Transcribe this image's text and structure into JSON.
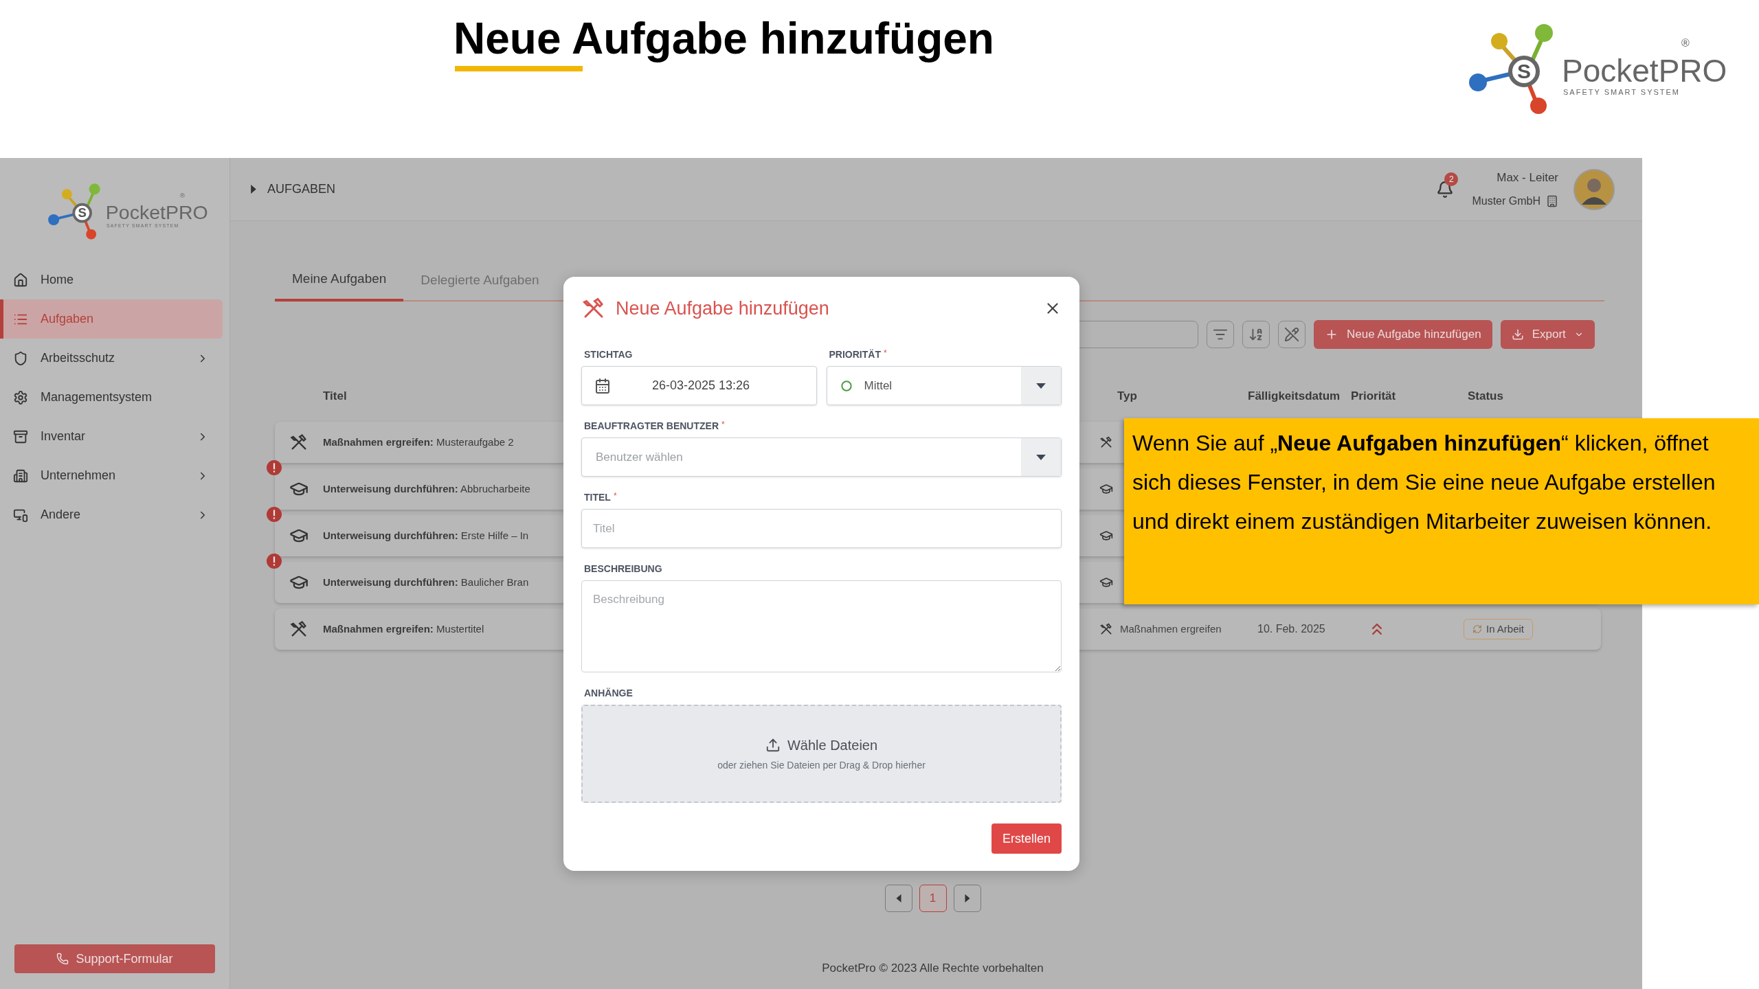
{
  "slide": {
    "title": "Neue Aufgabe hinzufügen",
    "logo": {
      "mark": "S",
      "name": "PocketPRO",
      "registered": "®",
      "tagline": "SAFETY SMART SYSTEM"
    }
  },
  "sidebar": {
    "logo": {
      "mark": "S",
      "name": "PocketPRO",
      "registered": "®",
      "tagline": "SAFETY SMART SYSTEM"
    },
    "items": [
      {
        "label": "Home",
        "selected": false,
        "has_submenu": false
      },
      {
        "label": "Aufgaben",
        "selected": true,
        "has_submenu": false
      },
      {
        "label": "Arbeitsschutz",
        "selected": false,
        "has_submenu": true
      },
      {
        "label": "Managementsystem",
        "selected": false,
        "has_submenu": false
      },
      {
        "label": "Inventar",
        "selected": false,
        "has_submenu": true
      },
      {
        "label": "Unternehmen",
        "selected": false,
        "has_submenu": true
      },
      {
        "label": "Andere",
        "selected": false,
        "has_submenu": true
      }
    ],
    "support_button": "Support-Formular"
  },
  "header": {
    "breadcrumb": "AUFGABEN",
    "notification_count": "2",
    "user_name": "Max - Leiter",
    "company": "Muster GmbH"
  },
  "tabs": [
    {
      "label": "Meine Aufgaben",
      "selected": true
    },
    {
      "label": "Delegierte Aufgaben",
      "selected": false
    }
  ],
  "toolbar": {
    "add_button": "Neue Aufgabe hinzufügen",
    "export_button": "Export"
  },
  "table": {
    "columns": [
      "Titel",
      "Typ",
      "Fälligkeitsdatum",
      "Priorität",
      "Status"
    ],
    "rows": [
      {
        "kind": "measure",
        "overdue": false,
        "title": "**Maßnahmen ergreifen:** Musteraufgabe 2"
      },
      {
        "kind": "training",
        "overdue": true,
        "title": "**Unterweisung durchführen:** Abbrucharbeite"
      },
      {
        "kind": "training",
        "overdue": true,
        "title": "**Unterweisung durchführen:** Erste Hilfe – In"
      },
      {
        "kind": "training",
        "overdue": true,
        "title": "**Unterweisung durchführen:** Baulicher Bran"
      },
      {
        "kind": "measure",
        "overdue": false,
        "title": "**Maßnahmen ergreifen:** Mustertitel",
        "type": "Maßnahmen ergreifen",
        "due_date": "10. Feb. 2025",
        "priority": {
          "kind": "high"
        },
        "status": "In Arbeit"
      }
    ]
  },
  "pagination": [
    {
      "label": "1",
      "selected": true
    }
  ],
  "footer": "PocketPro © 2023 Alle Rechte vorbehalten",
  "dialog": {
    "title": "Neue Aufgabe hinzufügen",
    "fields": [
      {
        "kind": "date",
        "label": "STICHTAG",
        "value": "26-03-2025 13:26"
      },
      {
        "kind": "priority",
        "label": "PRIORITÄT",
        "required_mark": "*",
        "value": "Mittel"
      },
      {
        "kind": "select",
        "label": "BEAUFTRAGTER BENUTZER",
        "required_mark": "*",
        "placeholder": "Benutzer wählen"
      },
      {
        "kind": "text",
        "label": "TITEL",
        "required_mark": "*",
        "placeholder": "Titel"
      },
      {
        "kind": "textarea",
        "label": "BESCHREIBUNG",
        "placeholder": "Beschreibung"
      },
      {
        "kind": "upload",
        "label": "ANHÄNGE",
        "button": "Wähle Dateien",
        "hint": "oder ziehen Sie Dateien per Drag & Drop hierher"
      }
    ],
    "submit": "Erstellen"
  },
  "callout": "Wenn Sie auf „**Neue Aufgaben hinzufügen**“ klicken, öffnet sich dieses Fenster, in dem Sie eine neue Aufgabe erstellen und direkt einem zuständigen Mitarbeiter zuweisen können."
}
